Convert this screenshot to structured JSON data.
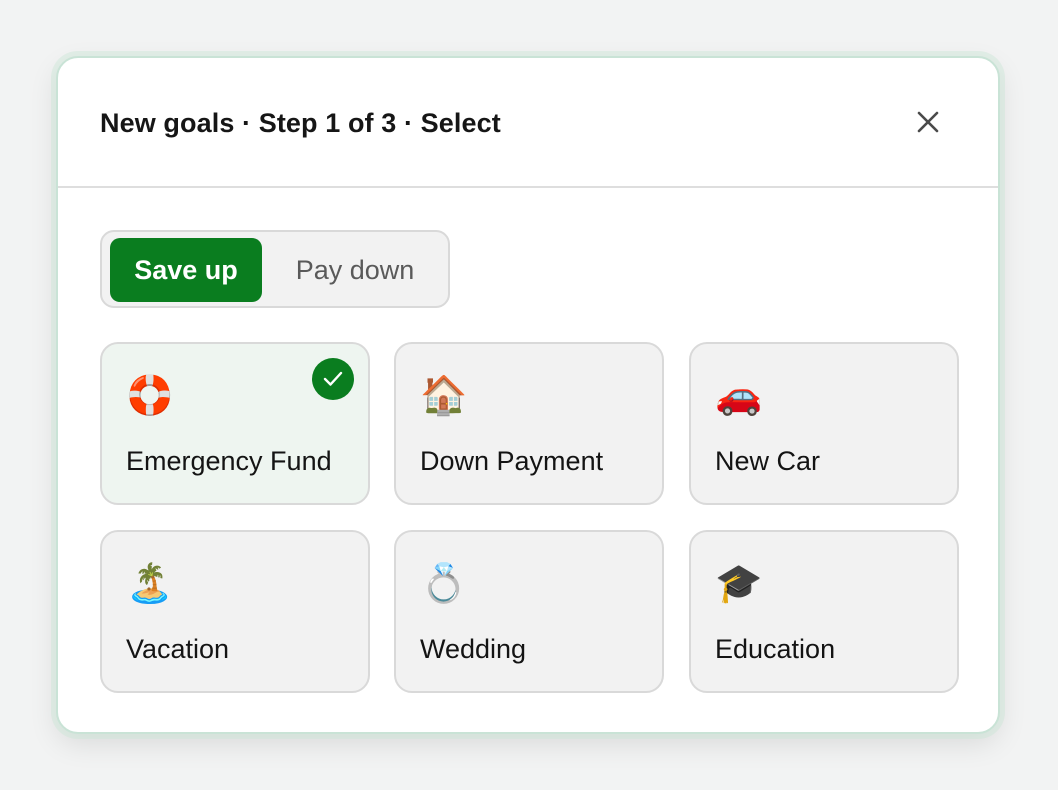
{
  "dialog": {
    "title": "New goals · Step 1 of 3 · Select",
    "close_icon": "close-icon"
  },
  "mode_toggle": {
    "options": [
      {
        "label": "Save up",
        "selected": true
      },
      {
        "label": "Pay down",
        "selected": false
      }
    ]
  },
  "goals": [
    {
      "label": "Emergency Fund",
      "emoji": "🛟",
      "icon": "life-buoy-icon",
      "selected": true
    },
    {
      "label": "Down Payment",
      "emoji": "🏠",
      "icon": "house-icon",
      "selected": false
    },
    {
      "label": "New Car",
      "emoji": "🚗",
      "icon": "car-icon",
      "selected": false
    },
    {
      "label": "Vacation",
      "emoji": "🏝️",
      "icon": "island-icon",
      "selected": false
    },
    {
      "label": "Wedding",
      "emoji": "💍",
      "icon": "ring-icon",
      "selected": false
    },
    {
      "label": "Education",
      "emoji": "🎓",
      "icon": "graduation-cap-icon",
      "selected": false
    }
  ],
  "colors": {
    "accent": "#0a7d1f",
    "card_bg": "#f2f2f2",
    "selected_card_bg": "#eef5f0",
    "modal_border": "#c9e3d6"
  }
}
